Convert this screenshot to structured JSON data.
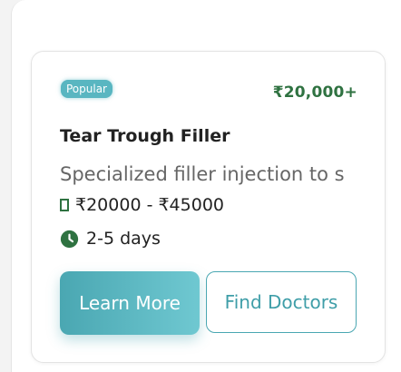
{
  "treatment_card": {
    "badge": "Popular",
    "starting_price": "₹20,000+",
    "title": "Tear Trough Filler",
    "description": "Specialized filler injection to s",
    "price_range": "₹20000 - ₹45000",
    "duration": "2-5 days",
    "learn_more_label": "Learn More",
    "find_doctors_label": "Find Doctors",
    "price_range_icon": "rectangle-icon",
    "duration_icon": "clock-icon",
    "accent_color": "#4aa7b2",
    "price_color": "#2f7241"
  }
}
